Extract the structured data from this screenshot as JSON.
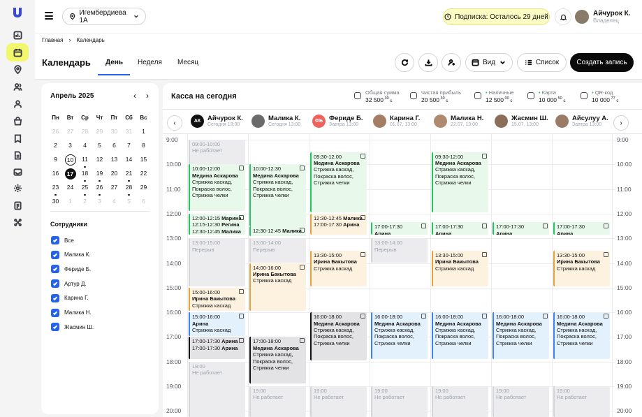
{
  "topbar": {
    "address": "Игембердиева 1А",
    "subscription": "Подписка: Осталось 29 дней",
    "user_name": "Айчурок К.",
    "user_role": "Владелец"
  },
  "breadcrumb": [
    "Главная",
    "Календарь"
  ],
  "header": {
    "title": "Календарь",
    "tabs": [
      "День",
      "Неделя",
      "Месяц"
    ],
    "view_label": "Вид",
    "list_label": "Список",
    "create_label": "Создать запись"
  },
  "calendar": {
    "month": "Апрель 2025",
    "weekdays": [
      "Пн",
      "Вт",
      "Ср",
      "Чт",
      "Пт",
      "Сб",
      "Вс"
    ],
    "weeks": [
      [
        "26",
        "27",
        "28",
        "29",
        "30",
        "31",
        "1"
      ],
      [
        "2",
        "3",
        "4",
        "5",
        "6",
        "7",
        "8"
      ],
      [
        "9",
        "10",
        "11",
        "12",
        "13",
        "14",
        "15"
      ],
      [
        "16",
        "17",
        "18",
        "19",
        "20",
        "21",
        "22"
      ],
      [
        "23",
        "24",
        "25",
        "26",
        "27",
        "28",
        "29"
      ],
      [
        "30",
        "1",
        "2",
        "3",
        "4",
        "5",
        "6"
      ]
    ]
  },
  "employees": {
    "title": "Сотрудники",
    "items": [
      "Все",
      "Малика К.",
      "Фериде Б.",
      "Артур Д.",
      "Карина Г.",
      "Малика Н.",
      "Жасмин Ш."
    ]
  },
  "kassa": {
    "title": "Касса на сегодня",
    "stats": [
      {
        "label": "Общая сумма",
        "value": "32 500",
        "cents": "30",
        "currency": "с"
      },
      {
        "label": "Чистая прибыль",
        "value": "20 500",
        "cents": "30",
        "currency": "с"
      },
      {
        "label": "Наличные",
        "value": "12 500",
        "cents": "00",
        "currency": "с"
      },
      {
        "label": "Карта",
        "value": "10 000",
        "cents": "50",
        "currency": "с"
      },
      {
        "label": "QR-код",
        "value": "10 000",
        "cents": "77",
        "currency": "с"
      }
    ]
  },
  "staff": [
    {
      "initials": "АК",
      "name": "Айчурок К.",
      "sub": "Сегодня 13:00",
      "color": "#111111"
    },
    {
      "initials": "",
      "name": "Малика К.",
      "sub": "Сегодня 13:00",
      "color": "#6b6b6b"
    },
    {
      "initials": "ФБ",
      "name": "Фериде Б.",
      "sub": "Завтра 13:00",
      "color": "#f0625d"
    },
    {
      "initials": "",
      "name": "Карина Г.",
      "sub": "01.07, 13:00",
      "color": "#a47e62"
    },
    {
      "initials": "",
      "name": "Малика Н.",
      "sub": "22.07, 13:00",
      "color": "#b08a70"
    },
    {
      "initials": "",
      "name": "Жасмин Ш.",
      "sub": "15.07, 13:00",
      "color": "#8b6e5a"
    },
    {
      "initials": "",
      "name": "Айсулуу А.",
      "sub": "Завтра 13:00",
      "color": "#9a7b66"
    }
  ],
  "hours": [
    "9:00",
    "10:00",
    "11:00",
    "12:00",
    "13:00",
    "14:00",
    "15:00",
    "16:00",
    "17:00",
    "18:00",
    "19:00",
    "20:00"
  ],
  "events": [
    {
      "col": 0,
      "start": 9.0,
      "end": 10.0,
      "c": "w",
      "time": "09:00-10:00",
      "name": "",
      "svc": "Не работает"
    },
    {
      "col": 0,
      "start": 10.0,
      "end": 11.9,
      "c": "g",
      "time": "10:00-12:00",
      "name": "Медина Аскарова",
      "svc": "Стрижка каскад, Покраска волос, Стрижка челки"
    },
    {
      "col": 0,
      "start": 12.0,
      "end": 12.85,
      "c": "g",
      "rows": [
        [
          "12:00-12:15",
          "Марина"
        ],
        [
          "12:15-12:30",
          "Регина"
        ],
        [
          "12:30-12:45",
          "Малика"
        ]
      ]
    },
    {
      "col": 0,
      "start": 13.0,
      "end": 14.95,
      "c": "w",
      "time": "13:00-15:00",
      "name": "",
      "svc": "Перерыв"
    },
    {
      "col": 0,
      "start": 15.0,
      "end": 15.95,
      "c": "o",
      "time": "15:00-16:00",
      "name": "Ирина Бакытова",
      "svc": "Стрижка каскад"
    },
    {
      "col": 0,
      "start": 16.0,
      "end": 16.95,
      "c": "b",
      "time": "15:00-16:00",
      "name": "Арина",
      "svc": "Стрижка каскад"
    },
    {
      "col": 0,
      "start": 17.0,
      "end": 17.9,
      "c": "k",
      "rows": [
        [
          "17:00-17:30",
          "Арина"
        ],
        [
          "17:00-17:30",
          "Арина"
        ]
      ]
    },
    {
      "col": 0,
      "start": 18.0,
      "end": 20.5,
      "c": "w",
      "time": "18:00",
      "name": "",
      "svc": "Не работает"
    },
    {
      "col": 1,
      "start": 10.0,
      "end": 12.5,
      "c": "g",
      "time": "10:00-12:30",
      "name": "Медина Аскарова",
      "svc": "Стрижка каскад, Покраска волос, Стрижка челки"
    },
    {
      "col": 1,
      "start": 12.5,
      "end": 12.9,
      "c": "g",
      "rows": [
        [
          "12:30-12:45",
          "Малика"
        ]
      ]
    },
    {
      "col": 1,
      "start": 13.0,
      "end": 14.0,
      "c": "w",
      "time": "13:00-14:00",
      "name": "",
      "svc": "Перерыв"
    },
    {
      "col": 1,
      "start": 14.0,
      "end": 15.95,
      "c": "o",
      "time": "14:00-16:00",
      "name": "Ирина Бакытова",
      "svc": "Стрижка каскад"
    },
    {
      "col": 1,
      "start": 17.0,
      "end": 18.9,
      "c": "k",
      "time": "17:00-18:00",
      "name": "Медина Аскарова",
      "svc": "Стрижка каскад, Покраска волос, Стрижка челки"
    },
    {
      "col": 1,
      "start": 19.0,
      "end": 20.5,
      "c": "w",
      "time": "19:00",
      "name": "",
      "svc": "Не работает"
    },
    {
      "col": 2,
      "start": 9.5,
      "end": 11.95,
      "c": "g",
      "time": "09:30-12:00",
      "name": "Медина Аскарова",
      "svc": "Стрижка каскад, Покраска волос, Стрижка челки"
    },
    {
      "col": 2,
      "start": 12.0,
      "end": 12.85,
      "c": "o",
      "rows": [
        [
          "12:30-12:45",
          "Малика"
        ],
        [
          "17:00-17:30",
          "Арина"
        ]
      ]
    },
    {
      "col": 2,
      "start": 13.5,
      "end": 14.95,
      "c": "o",
      "time": "13:30-15:00",
      "name": "Ирина Бакытова",
      "svc": "Стрижка каскад"
    },
    {
      "col": 2,
      "start": 16.0,
      "end": 17.95,
      "c": "k",
      "time": "16:00-18:00",
      "name": "Медина Аскарова",
      "svc": "Стрижка каскад, Покраска волос, Стрижка челки"
    },
    {
      "col": 2,
      "start": 19.0,
      "end": 20.5,
      "c": "w",
      "time": "19:00",
      "name": "",
      "svc": "Не работает"
    },
    {
      "col": 3,
      "start": 12.35,
      "end": 12.85,
      "c": "g",
      "time": "17:00-17:30",
      "name": "Арина",
      "svc": ""
    },
    {
      "col": 3,
      "start": 13.0,
      "end": 14.0,
      "c": "w",
      "time": "13:00-14:00",
      "name": "",
      "svc": "Перерыв"
    },
    {
      "col": 3,
      "start": 16.0,
      "end": 17.9,
      "c": "b",
      "time": "16:00-18:00",
      "name": "Медина Аскарова",
      "svc": "Стрижка каскад, Покраска волос, Стрижка челки"
    },
    {
      "col": 3,
      "start": 19.0,
      "end": 20.5,
      "c": "w",
      "time": "19:00",
      "name": "",
      "svc": "Не работает"
    },
    {
      "col": 4,
      "start": 9.5,
      "end": 11.95,
      "c": "g",
      "time": "09:30-12:00",
      "name": "Медина Аскарова",
      "svc": "Стрижка каскад, Покраска волос, Стрижка челки"
    },
    {
      "col": 4,
      "start": 12.35,
      "end": 12.85,
      "c": "g",
      "time": "17:00-17:30",
      "name": "Арина",
      "svc": ""
    },
    {
      "col": 4,
      "start": 13.5,
      "end": 14.95,
      "c": "o",
      "time": "13:30-15:00",
      "name": "Ирина Бакытова",
      "svc": "Стрижка каскад"
    },
    {
      "col": 4,
      "start": 16.0,
      "end": 17.9,
      "c": "b",
      "time": "16:00-18:00",
      "name": "Медина Аскарова",
      "svc": "Стрижка каскад, Покраска волос, Стрижка челки"
    },
    {
      "col": 4,
      "start": 19.0,
      "end": 20.5,
      "c": "w",
      "time": "19:00",
      "name": "",
      "svc": "Не работает"
    },
    {
      "col": 5,
      "start": 12.35,
      "end": 12.85,
      "c": "g",
      "time": "17:00-17:30",
      "name": "Арина",
      "svc": ""
    },
    {
      "col": 5,
      "start": 16.0,
      "end": 17.9,
      "c": "b",
      "time": "16:00-18:00",
      "name": "Медина Аскарова",
      "svc": "Стрижка каскад, Покраска волос, Стрижка челки"
    },
    {
      "col": 5,
      "start": 19.0,
      "end": 20.5,
      "c": "w",
      "time": "19:00",
      "name": "",
      "svc": "Не работает"
    },
    {
      "col": 6,
      "start": 12.35,
      "end": 12.85,
      "c": "g",
      "time": "17:00-17:30",
      "name": "Арина",
      "svc": ""
    },
    {
      "col": 6,
      "start": 13.5,
      "end": 14.95,
      "c": "o",
      "time": "13:30-15:00",
      "name": "Ирина Бакытова",
      "svc": "Стрижка каскад"
    },
    {
      "col": 6,
      "start": 16.0,
      "end": 17.9,
      "c": "b",
      "time": "16:00-18:00",
      "name": "Медина Аскарова",
      "svc": "Стрижка каскад, Покраска волос, Стрижка челки"
    },
    {
      "col": 6,
      "start": 19.0,
      "end": 20.5,
      "c": "w",
      "time": "19:00",
      "name": "",
      "svc": "Не работает"
    }
  ]
}
